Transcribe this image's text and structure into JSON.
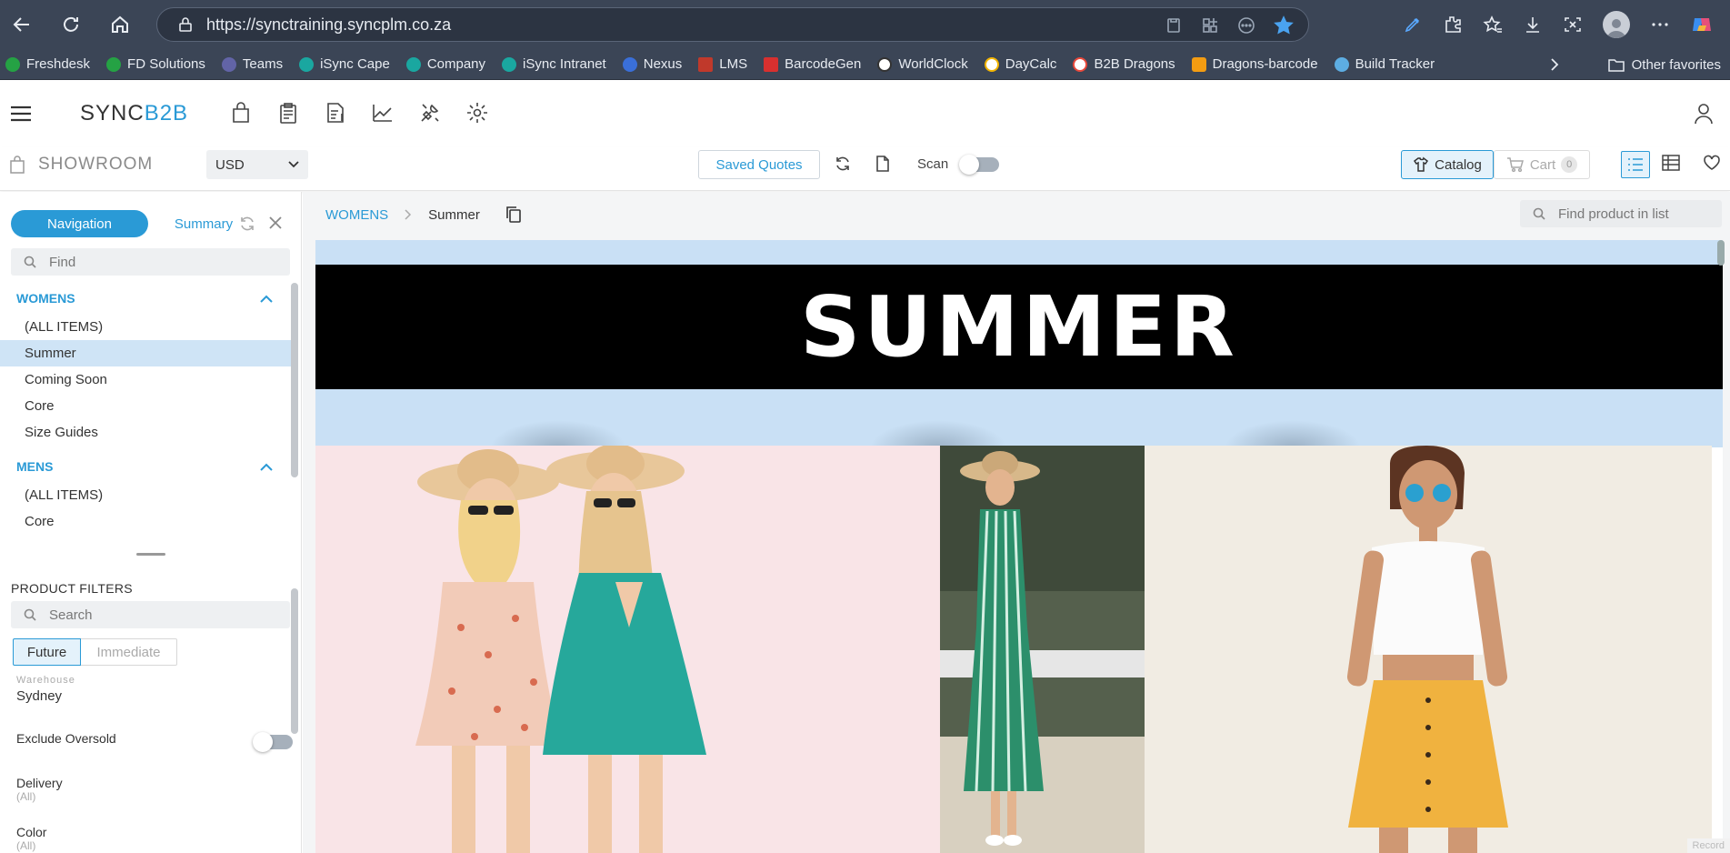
{
  "browser": {
    "url": "https://synctraining.syncplm.co.za",
    "bookmarks": [
      {
        "label": "Freshdesk",
        "color": "#25a244"
      },
      {
        "label": "FD Solutions",
        "color": "#25a244"
      },
      {
        "label": "Teams",
        "color": "#6264a7"
      },
      {
        "label": "iSync Cape",
        "color": "#1aa7a0"
      },
      {
        "label": "Company",
        "color": "#1aa7a0"
      },
      {
        "label": "iSync Intranet",
        "color": "#1aa7a0"
      },
      {
        "label": "Nexus",
        "color": "#3a6fd8"
      },
      {
        "label": "LMS",
        "color": "#c0392b"
      },
      {
        "label": "BarcodeGen",
        "color": "#d8302f"
      },
      {
        "label": "WorldClock",
        "color": "#ffffff"
      },
      {
        "label": "DayCalc",
        "color": "#f2b400"
      },
      {
        "label": "B2B Dragons",
        "color": "#e8483b"
      },
      {
        "label": "Dragons-barcode",
        "color": "#f39c12"
      },
      {
        "label": "Build Tracker",
        "color": "#5dade2"
      }
    ],
    "other_favorites": "Other favorites"
  },
  "app": {
    "brand_prefix": "SYNC",
    "brand_suffix": "B2B",
    "accent": "#2a9ad6"
  },
  "toolbar": {
    "showroom": "SHOWROOM",
    "currency": "USD",
    "saved_quotes": "Saved Quotes",
    "scan": "Scan",
    "catalog": "Catalog",
    "cart": "Cart",
    "cart_count": "0"
  },
  "sidebar": {
    "tab_navigation": "Navigation",
    "tab_summary": "Summary",
    "find_placeholder": "Find",
    "groups": [
      {
        "title": "WOMENS",
        "items": [
          "(ALL ITEMS)",
          "Summer",
          "Coming Soon",
          "Core",
          "Size Guides"
        ],
        "selected": "Summer"
      },
      {
        "title": "MENS",
        "items": [
          "(ALL ITEMS)",
          "Core"
        ]
      }
    ],
    "filters": {
      "title": "PRODUCT FILTERS",
      "search_placeholder": "Search",
      "seg_future": "Future",
      "seg_immediate": "Immediate",
      "warehouse_label": "Warehouse",
      "warehouse_value": "Sydney",
      "exclude_oversold": "Exclude Oversold",
      "delivery_label": "Delivery",
      "delivery_value": "(All)",
      "color_label": "Color",
      "color_value": "(All)"
    }
  },
  "main": {
    "breadcrumb_root": "WOMENS",
    "breadcrumb_current": "Summer",
    "find_placeholder": "Find product in list",
    "banner_title": "SUMMER",
    "record_tag": "Record"
  }
}
